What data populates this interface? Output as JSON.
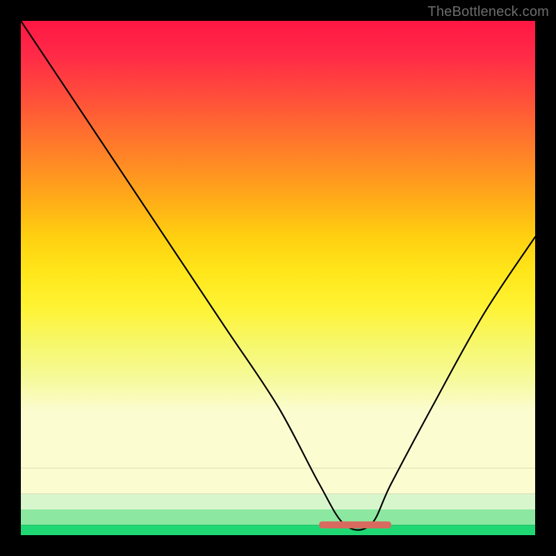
{
  "watermark": {
    "text": "TheBottleneck.com"
  },
  "chart_data": {
    "type": "line",
    "title": "",
    "xlabel": "",
    "ylabel": "",
    "xlim": [
      0,
      100
    ],
    "ylim": [
      0,
      100
    ],
    "curve": {
      "name": "bottleneck-curve",
      "x": [
        0,
        10,
        20,
        30,
        40,
        50,
        58,
        63,
        68,
        72,
        80,
        90,
        100
      ],
      "values": [
        100,
        85,
        70,
        55,
        40,
        25,
        10,
        2,
        2,
        10,
        25,
        43,
        58
      ]
    },
    "optimum_band": {
      "x_start": 58,
      "x_end": 72,
      "y": 2,
      "thickness": 5,
      "color": "#d86a5f"
    },
    "background_bands": [
      {
        "color": "#ff1744",
        "y_start": 100,
        "y_end": 92
      },
      {
        "color": "#ff2b47",
        "y_start": 92,
        "y_end": 84
      },
      {
        "color": "#ff4a3c",
        "y_start": 84,
        "y_end": 76
      },
      {
        "color": "#ff6b30",
        "y_start": 76,
        "y_end": 68
      },
      {
        "color": "#ff8b24",
        "y_start": 68,
        "y_end": 60
      },
      {
        "color": "#ffac18",
        "y_start": 60,
        "y_end": 52
      },
      {
        "color": "#ffcf10",
        "y_start": 52,
        "y_end": 44
      },
      {
        "color": "#ffe61a",
        "y_start": 44,
        "y_end": 36
      },
      {
        "color": "#fff334",
        "y_start": 36,
        "y_end": 28
      },
      {
        "color": "#f7f76a",
        "y_start": 28,
        "y_end": 20
      },
      {
        "color": "#f6fa9a",
        "y_start": 20,
        "y_end": 13
      },
      {
        "color": "#fbfccf",
        "y_start": 13,
        "y_end": 8
      },
      {
        "color": "#d8f6cc",
        "y_start": 8,
        "y_end": 5
      },
      {
        "color": "#8ce8a0",
        "y_start": 5,
        "y_end": 2
      },
      {
        "color": "#1fd873",
        "y_start": 2,
        "y_end": 0
      }
    ]
  }
}
